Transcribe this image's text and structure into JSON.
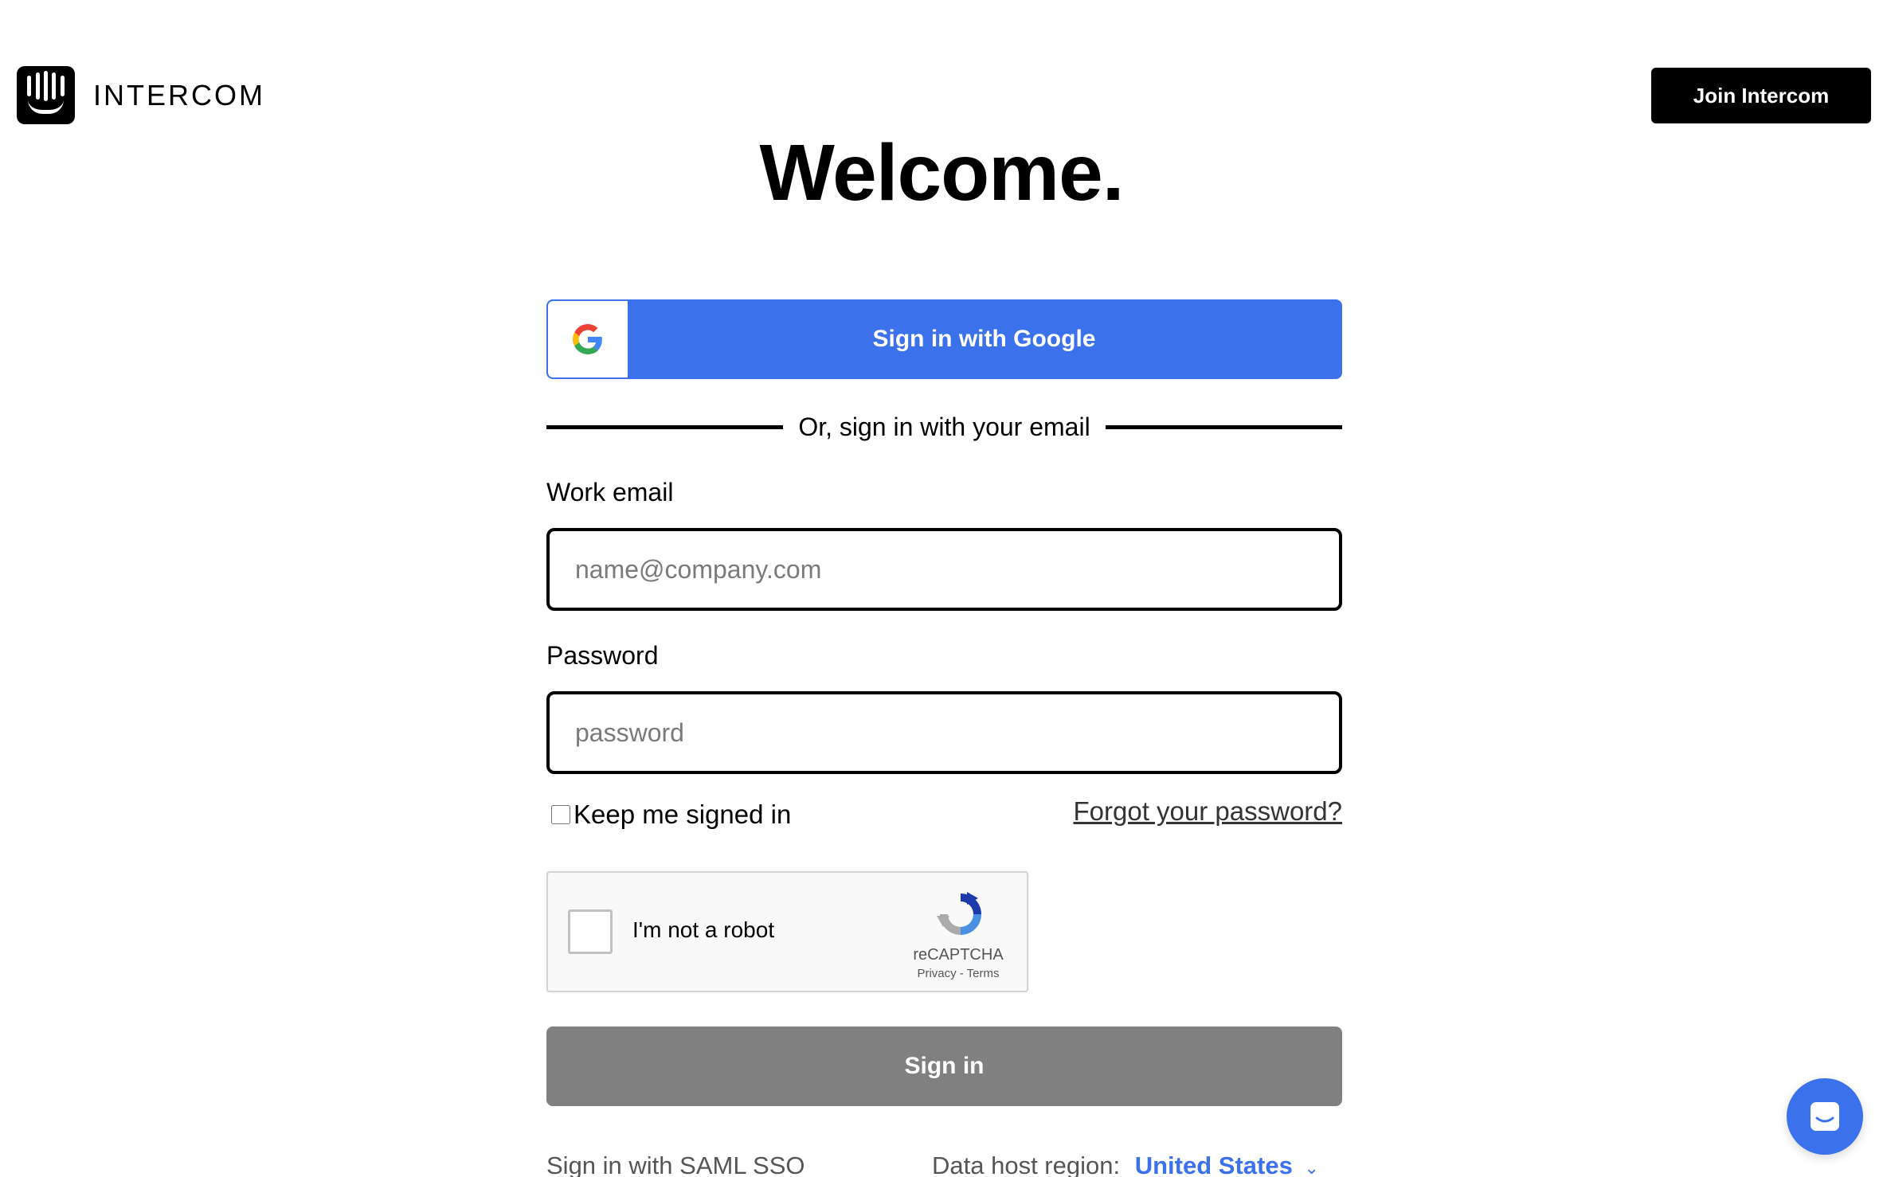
{
  "header": {
    "logo_text": "INTERCOM",
    "join_label": "Join Intercom"
  },
  "main": {
    "title": "Welcome.",
    "google_label": "Sign in with Google",
    "divider_text": "Or, sign in with your email",
    "email_label": "Work email",
    "email_placeholder": "name@company.com",
    "password_label": "Password",
    "password_placeholder": "password",
    "keep_signed_in": "Keep me signed in",
    "forgot_password": "Forgot your password?",
    "signin_label": "Sign in",
    "saml_link": "Sign in with SAML SSO",
    "region_label": "Data host region:",
    "region_value": "United States"
  },
  "recaptcha": {
    "label": "I'm not a robot",
    "brand": "reCAPTCHA",
    "links": "Privacy - Terms"
  },
  "icons": {
    "logo": "intercom-logo-icon",
    "google": "google-g-icon",
    "recaptcha": "recaptcha-logo-icon",
    "messenger": "chat-bubble-icon",
    "chevron": "chevron-down-icon"
  },
  "colors": {
    "brand_blue": "#3b71eb",
    "disabled_button": "#808080",
    "text_primary": "#000000"
  }
}
